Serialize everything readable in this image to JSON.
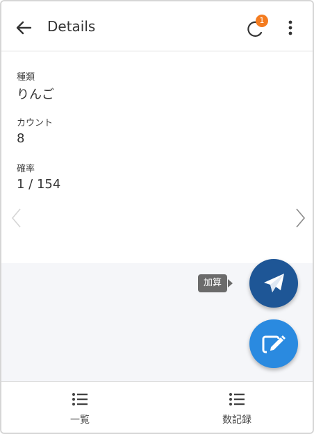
{
  "header": {
    "title": "Details",
    "badge_count": "1",
    "back_icon": "arrow-left-icon",
    "reload_icon": "reload-icon",
    "menu_icon": "more-vertical-icon"
  },
  "fields": [
    {
      "label": "種類",
      "value": "りんご"
    },
    {
      "label": "カウント",
      "value": "8"
    },
    {
      "label": "確率",
      "value": "1 / 154"
    }
  ],
  "fabs": {
    "send_tooltip": "加算",
    "send_icon": "paper-plane-icon",
    "edit_icon": "edit-icon"
  },
  "bottom_nav": [
    {
      "label": "一覧",
      "icon": "list-icon"
    },
    {
      "label": "数記録",
      "icon": "list-icon"
    }
  ],
  "colors": {
    "badge": "#f47c20",
    "fab_send": "#1e5696",
    "fab_edit": "#2a8ae0",
    "grey_area": "#f5f6f9"
  }
}
